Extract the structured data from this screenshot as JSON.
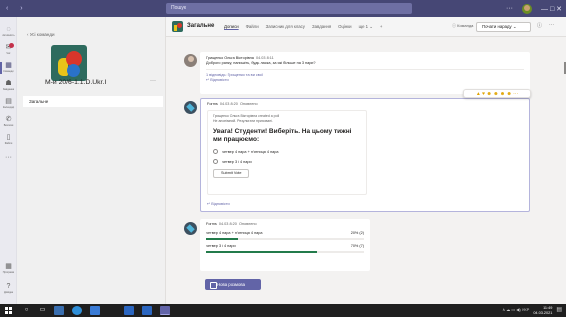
{
  "titlebar": {
    "nav_arrows": "‹ ›",
    "search_placeholder": "Пошук",
    "more": "···",
    "window_controls": "—  □  ✕"
  },
  "rail": {
    "items": [
      {
        "name": "activity",
        "icon": "bell-icon",
        "glyph": "◌",
        "label": "Активність",
        "badge": false
      },
      {
        "name": "chat",
        "icon": "chat-icon",
        "glyph": "✉",
        "label": "Чат",
        "badge": true
      },
      {
        "name": "teams",
        "icon": "teams-icon",
        "glyph": "▦",
        "label": "Команди",
        "active": true
      },
      {
        "name": "assignments",
        "icon": "assignments-icon",
        "glyph": "☗",
        "label": "Завдання"
      },
      {
        "name": "calendar",
        "icon": "calendar-icon",
        "glyph": "▤",
        "label": "Календар"
      },
      {
        "name": "calls",
        "icon": "phone-icon",
        "glyph": "✆",
        "label": "Виклики"
      },
      {
        "name": "files",
        "icon": "file-icon",
        "glyph": "▯",
        "label": "Файли"
      },
      {
        "name": "more",
        "icon": "more-icon",
        "glyph": "···",
        "label": ""
      }
    ],
    "bottom": [
      {
        "name": "apps",
        "icon": "apps-icon",
        "glyph": "▦",
        "label": "Програми"
      },
      {
        "name": "help",
        "icon": "help-icon",
        "glyph": "?",
        "label": "Довідка"
      }
    ]
  },
  "leftpane": {
    "back_link": "‹ Усі команди",
    "team_name": "М-и 20/6-1.1.D.Ukr.I",
    "team_more": "···",
    "channel": "Загальне"
  },
  "channel_header": {
    "title": "Загальне",
    "tabs": [
      "Дописи",
      "Файли",
      "Записник для класу",
      "Завдання",
      "Оцінки",
      "ще 1 ⌄",
      "+"
    ],
    "team_pill": "ⓘ Команда",
    "meet_label": "Почати нараду ⌄",
    "info": "ⓘ",
    "more": "···"
  },
  "messages": [
    {
      "author": "Грищенко Ольга Вікторівна",
      "time": "04.03 8:11",
      "text": "Доброго ранку, напишіть, будь ласка, за які більше на 3 пари?",
      "link": "1 відповідь: Грищенко та ви свої",
      "reply": "↵ Відповісти"
    },
    {
      "author": "Forms",
      "time": "04.03 8:20",
      "edited": "Оновлено",
      "card_line1": "Грищенко Ольга Вікторівна created a poll",
      "card_line2": "Не анонімний. Результати приховані.",
      "question": "Увага! Студенти! Виберіть. На цьому тижні ми працюємо:",
      "options": [
        "четвер 4 пара + п'ятниця 4 пара",
        "четвер 3 і 4 пари"
      ],
      "submit": "Submit Vote",
      "reply": "↵ Відповісти",
      "reactions": "▲ ♥ ☻ ☻ ☻ ☻ ···"
    },
    {
      "author": "Forms",
      "time": "04.03 8:20",
      "edited": "Оновлено",
      "results": [
        {
          "label": "четвер 4 пара + п'ятниця 4 пара",
          "value": "20% (2)",
          "fraction": 0.2
        },
        {
          "label": "четвер 3 і 4 пари",
          "value": "70% (7)",
          "fraction": 0.7
        }
      ]
    }
  ],
  "new_conversation": "Нова розмова",
  "taskbar": {
    "apps": [
      "search",
      "task-view",
      "file-explorer",
      "edge",
      "store",
      "mail",
      "photos",
      "teams"
    ],
    "tray": "∧ ☁ ▭ ◀) УКР",
    "time": "11:49",
    "date": "04.03.2021"
  },
  "colors": {
    "accent": "#6264a7",
    "titlebar": "#464775",
    "progress": "#237b4b"
  }
}
